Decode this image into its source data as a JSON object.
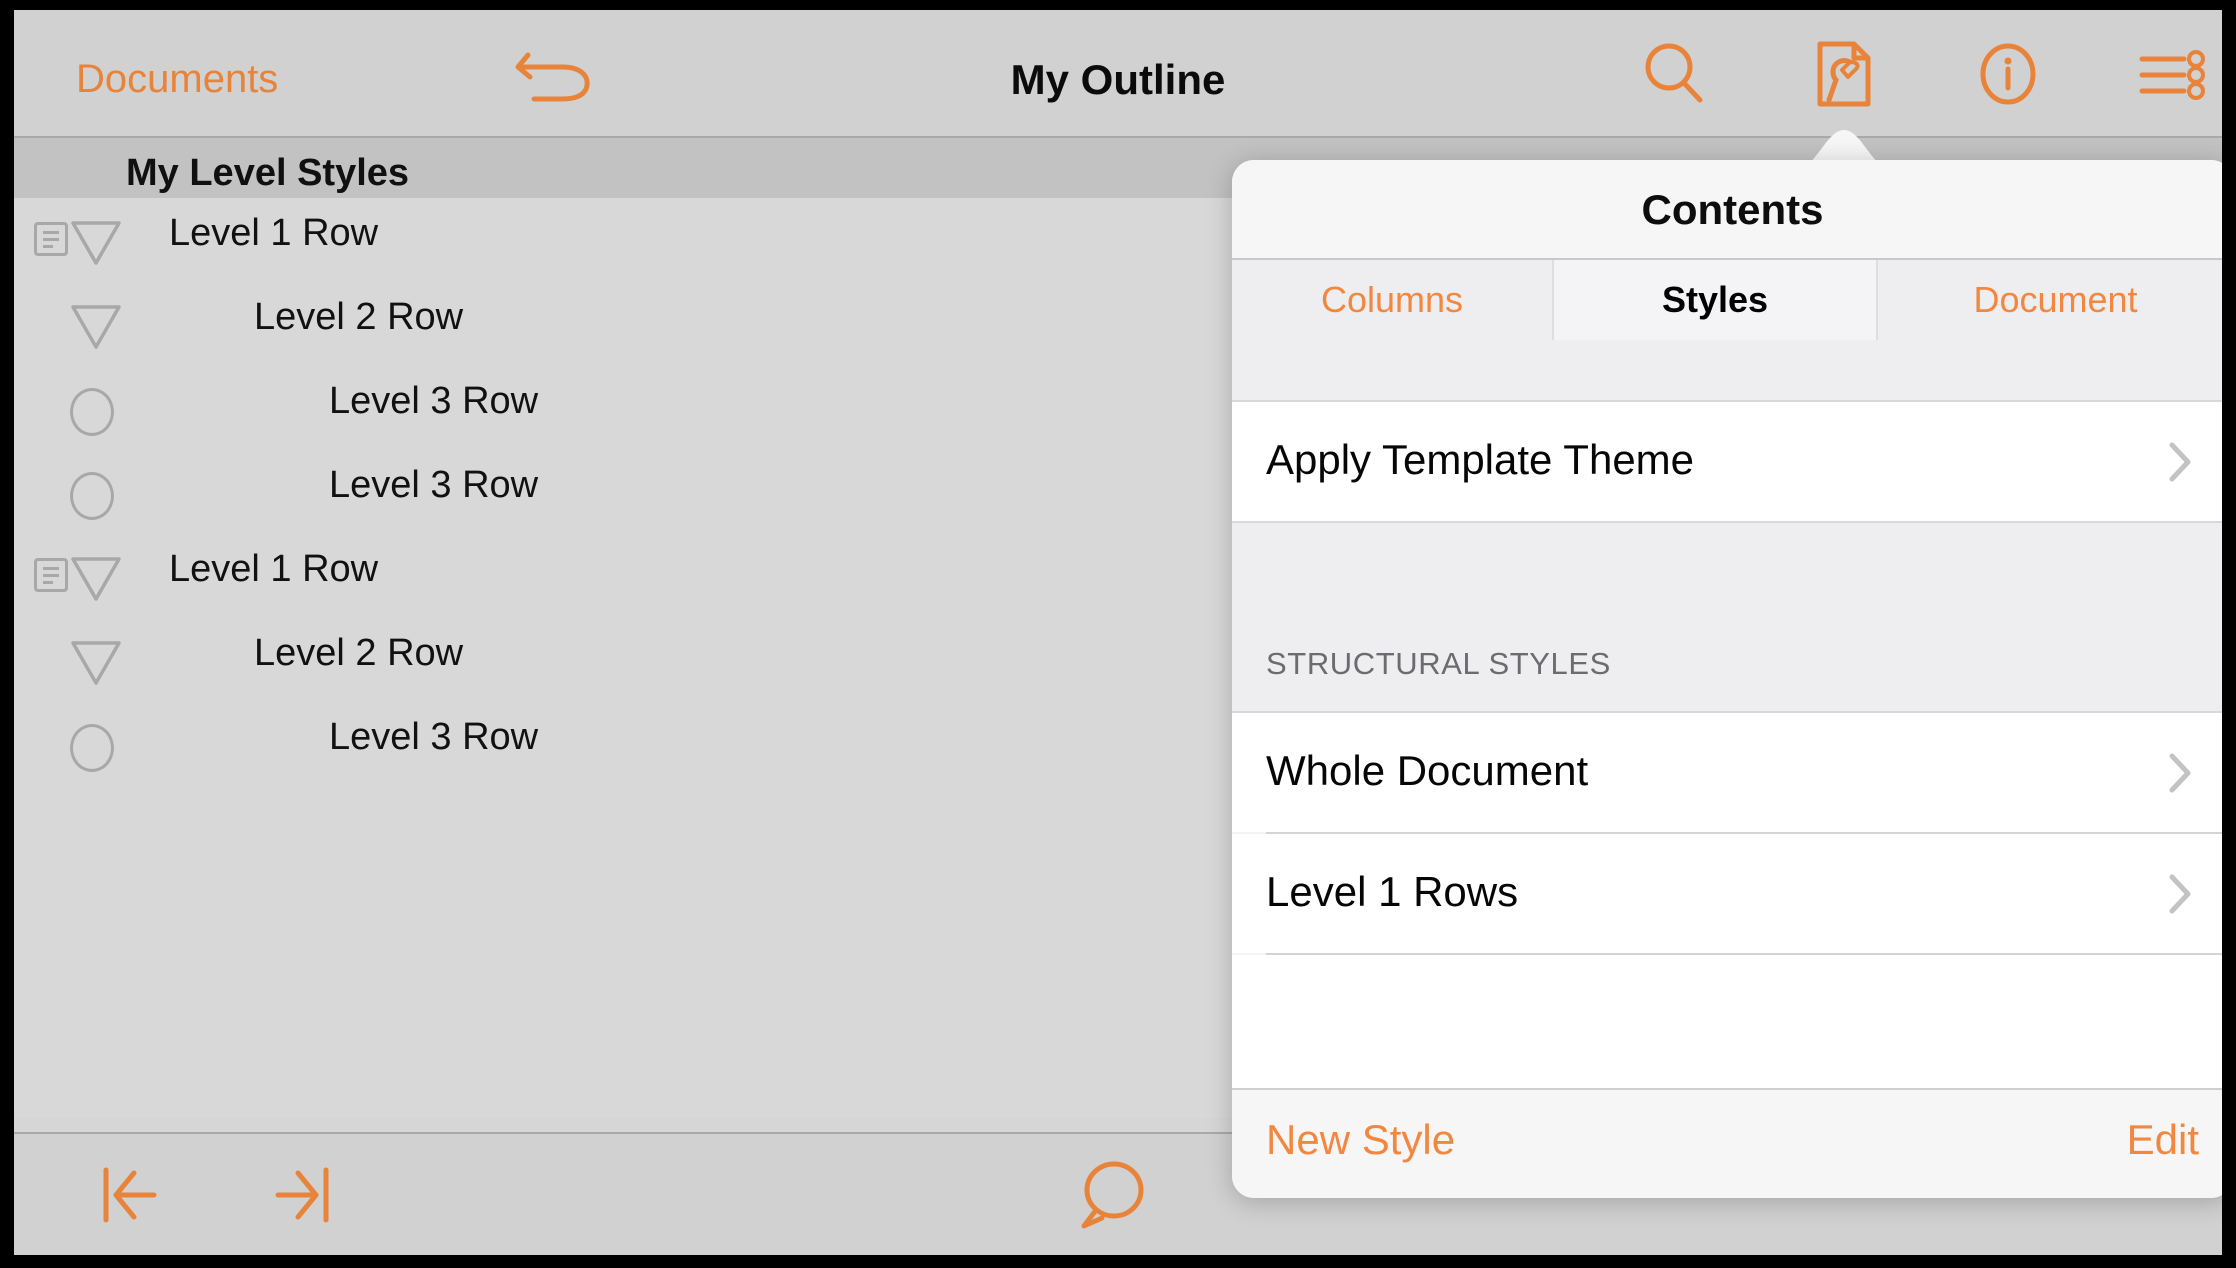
{
  "colors": {
    "accent_orange": "#e8833a",
    "toolbar_bg": "#d1d1d1",
    "outline_bg": "#d8d8d8",
    "outline_header_bg": "#c2c2c2",
    "popover_bg": "#f4f4f6",
    "row_bg": "#ffffff"
  },
  "toolbar": {
    "back_label": "Documents",
    "undo_icon": "undo-arrow-icon",
    "title": "My Outline",
    "icons": [
      {
        "name": "search-icon",
        "label": "Search"
      },
      {
        "name": "contents-wrench-document-icon",
        "label": "Contents"
      },
      {
        "name": "info-circle-icon",
        "label": "Info"
      },
      {
        "name": "outline-list-icon",
        "label": "Outline Options"
      }
    ]
  },
  "outline": {
    "header_title": "My Level Styles",
    "rows": [
      {
        "level": 1,
        "label": "Level 1 Row",
        "marker": "triangle",
        "has_note": true
      },
      {
        "level": 2,
        "label": "Level 2 Row",
        "marker": "triangle",
        "has_note": false
      },
      {
        "level": 3,
        "label": "Level 3 Row",
        "marker": "circle",
        "has_note": false
      },
      {
        "level": 3,
        "label": "Level 3 Row",
        "marker": "circle",
        "has_note": false
      },
      {
        "level": 1,
        "label": "Level 1 Row",
        "marker": "triangle",
        "has_note": true
      },
      {
        "level": 2,
        "label": "Level 2 Row",
        "marker": "triangle",
        "has_note": false
      },
      {
        "level": 3,
        "label": "Level 3 Row",
        "marker": "circle",
        "has_note": false
      }
    ]
  },
  "bottombar": {
    "icons": [
      {
        "name": "outdent-icon",
        "label": "Outdent"
      },
      {
        "name": "indent-icon",
        "label": "Indent"
      },
      {
        "name": "comment-bubble-icon",
        "label": "Comment"
      }
    ]
  },
  "popover": {
    "title": "Contents",
    "tabs": [
      {
        "label": "Columns",
        "selected": false
      },
      {
        "label": "Styles",
        "selected": true
      },
      {
        "label": "Document",
        "selected": false
      }
    ],
    "apply_theme_row": {
      "label": "Apply Template Theme",
      "chevron": "chevron-right-icon"
    },
    "section_header": "STRUCTURAL STYLES",
    "style_rows": [
      {
        "label": "Whole Document",
        "chevron": "chevron-right-icon"
      },
      {
        "label": "Level 1 Rows",
        "chevron": "chevron-right-icon"
      }
    ],
    "footer": {
      "new_style_label": "New Style",
      "edit_label": "Edit"
    }
  }
}
